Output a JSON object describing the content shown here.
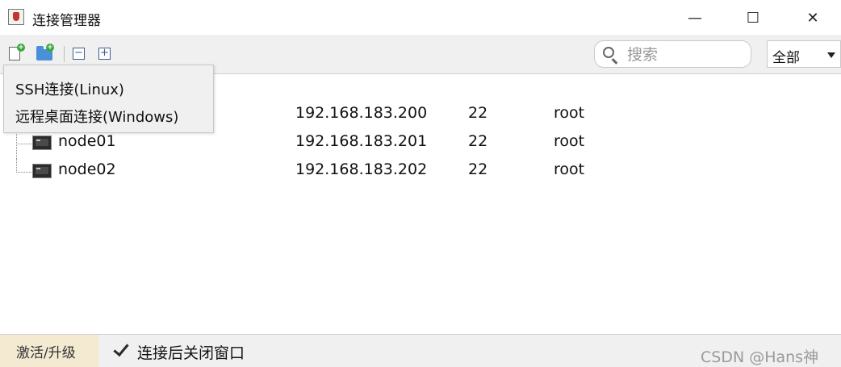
{
  "window": {
    "title": "连接管理器",
    "minimize_glyph": "—",
    "maximize_glyph": "☐",
    "close_glyph": "✕"
  },
  "toolbar": {
    "buttons": [
      {
        "icon": "new-connection-icon"
      },
      {
        "icon": "new-folder-icon"
      },
      {
        "icon": "collapse-all-icon",
        "glyph": "−"
      },
      {
        "icon": "expand-all-icon",
        "glyph": "+"
      }
    ],
    "search": {
      "placeholder": "搜索",
      "value": ""
    },
    "filter": {
      "selected": "全部"
    }
  },
  "popup_menu": {
    "items": [
      {
        "label": "SSH连接(Linux)"
      },
      {
        "label": "远程桌面连接(Windows)"
      }
    ]
  },
  "tree": {
    "rows": [
      {
        "name": "",
        "ip": "192.168.183.200",
        "port": "22",
        "user": "root"
      },
      {
        "name": "node01",
        "ip": "192.168.183.201",
        "port": "22",
        "user": "root"
      },
      {
        "name": "node02",
        "ip": "192.168.183.202",
        "port": "22",
        "user": "root"
      }
    ]
  },
  "statusbar": {
    "activate_label": "激活/升级",
    "close_after_connect_label": "连接后关闭窗口",
    "close_after_connect_checked": true
  },
  "watermark": "CSDN @Hans神"
}
